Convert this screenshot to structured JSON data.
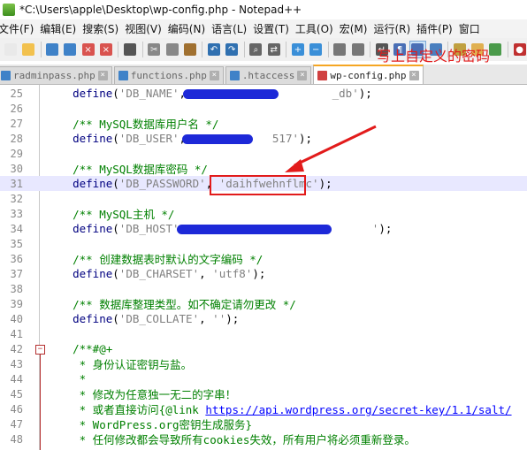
{
  "window": {
    "title": "*C:\\Users\\apple\\Desktop\\wp-config.php - Notepad++"
  },
  "menu": [
    "文件(F)",
    "编辑(E)",
    "搜索(S)",
    "视图(V)",
    "编码(N)",
    "语言(L)",
    "设置(T)",
    "工具(O)",
    "宏(M)",
    "运行(R)",
    "插件(P)",
    "窗口"
  ],
  "toolbar": [
    "new-file-icon",
    "open-file-icon",
    "save-icon",
    "save-all-icon",
    "close-icon",
    "close-all-icon",
    "print-icon",
    "cut-icon",
    "copy-icon",
    "paste-icon",
    "undo-icon",
    "redo-icon",
    "find-icon",
    "replace-icon",
    "zoom-in-icon",
    "zoom-out-icon",
    "sync-v-icon",
    "sync-h-icon",
    "wrap-icon",
    "show-all-chars-icon",
    "indent-guide-icon",
    "doc-map-icon",
    "function-list-icon",
    "folder-workspace-icon",
    "monitor-icon",
    "record-icon"
  ],
  "tabs": [
    {
      "label": "radminpass.php",
      "active": false,
      "saved": true
    },
    {
      "label": "functions.php",
      "active": false,
      "saved": true
    },
    {
      "label": ".htaccess",
      "active": false,
      "saved": true
    },
    {
      "label": "wp-config.php",
      "active": true,
      "saved": false
    }
  ],
  "annotation": "写上自定义的密码",
  "code_lines": [
    {
      "n": "25",
      "t": "    define('DB_NAME', '                    _db');"
    },
    {
      "n": "26",
      "t": ""
    },
    {
      "n": "27",
      "t": "    /** MySQL数据库用户名 */"
    },
    {
      "n": "28",
      "t": "    define('DB_USER', '           517');"
    },
    {
      "n": "29",
      "t": ""
    },
    {
      "n": "30",
      "t": "    /** MySQL数据库密码 */"
    },
    {
      "n": "31",
      "t": "    define('DB_PASSWORD', 'daihfwehnflmc');"
    },
    {
      "n": "32",
      "t": ""
    },
    {
      "n": "33",
      "t": "    /** MySQL主机 */"
    },
    {
      "n": "34",
      "t": "    define('DB_HOST', '                          ');"
    },
    {
      "n": "35",
      "t": ""
    },
    {
      "n": "36",
      "t": "    /** 创建数据表时默认的文字编码 */"
    },
    {
      "n": "37",
      "t": "    define('DB_CHARSET', 'utf8');"
    },
    {
      "n": "38",
      "t": ""
    },
    {
      "n": "39",
      "t": "    /** 数据库整理类型。如不确定请勿更改 */"
    },
    {
      "n": "40",
      "t": "    define('DB_COLLATE', '');"
    },
    {
      "n": "41",
      "t": ""
    },
    {
      "n": "42",
      "t": "    /**#@+"
    },
    {
      "n": "43",
      "t": "     * 身份认证密钥与盐。"
    },
    {
      "n": "44",
      "t": "     *"
    },
    {
      "n": "45",
      "t": "     * 修改为任意独一无二的字串！"
    },
    {
      "n": "46",
      "t": "     * 或者直接访问{@link https://api.wordpress.org/secret-key/1.1/salt/"
    },
    {
      "n": "47",
      "t": "     * WordPress.org密钥生成服务}"
    },
    {
      "n": "48",
      "t": "     * 任何修改都会导致所有cookies失效，所有用户将必须重新登录。"
    }
  ]
}
